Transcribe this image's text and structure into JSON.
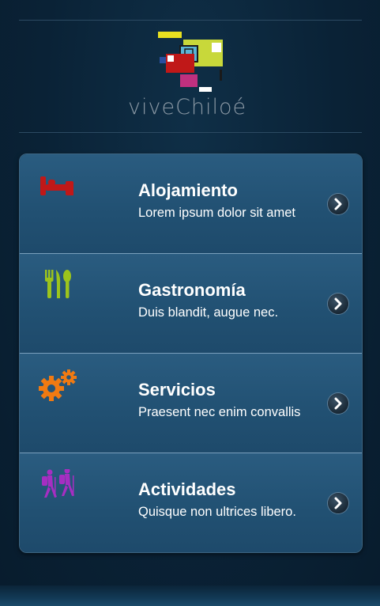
{
  "brand": {
    "logo_text": "viveChiloé",
    "colors": {
      "yellow": "#e8e020",
      "lime": "#c8d83a",
      "red": "#c01818",
      "magenta": "#c0307f",
      "blue": "#2a4ea0",
      "cyan": "#5ab4d6"
    }
  },
  "menu": {
    "items": [
      {
        "title": "Alojamiento",
        "subtitle": "Lorem ipsum dolor sit amet",
        "icon": "bed-icon",
        "icon_color": "#c01818"
      },
      {
        "title": "Gastronomía",
        "subtitle": "Duis blandit, augue nec.",
        "icon": "cutlery-icon",
        "icon_color": "#9cc41c"
      },
      {
        "title": "Servicios",
        "subtitle": "Praesent nec enim convallis",
        "icon": "gears-icon",
        "icon_color": "#f07a12"
      },
      {
        "title": "Actividades",
        "subtitle": "Quisque non ultrices libero.",
        "icon": "hikers-icon",
        "icon_color": "#a62ec2"
      }
    ]
  },
  "chevron_icon": "chevron-right-icon"
}
